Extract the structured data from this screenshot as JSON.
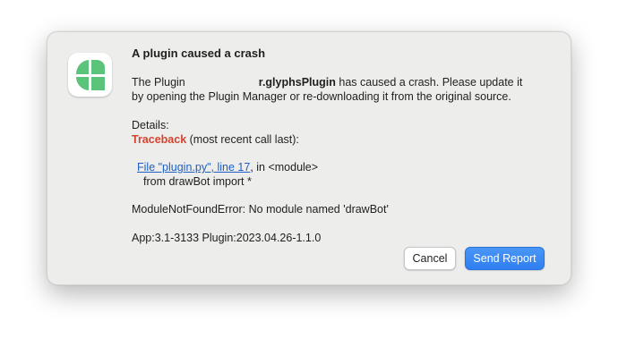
{
  "dialog": {
    "title": "A plugin caused a crash",
    "message_prefix": "The Plugin",
    "plugin_name": "r.glyphsPlugin",
    "message_line1_suffix": " has caused a crash. Please update it",
    "message_line2": "by opening the Plugin Manager or re-downloading it from the original source.",
    "details_label": "Details:",
    "traceback_word": "Traceback",
    "traceback_rest": " (most recent call last):",
    "frame_link": "File \"plugin.py\", line 17",
    "frame_link_suffix": ", in <module>",
    "frame_code": "from drawBot import *",
    "error_line": "ModuleNotFoundError: No module named 'drawBot'",
    "app_line": "App:3.1-3133 Plugin:2023.04.26-1.1.0"
  },
  "buttons": {
    "cancel_label": "Cancel",
    "send_label": "Send Report"
  },
  "icon": {
    "name": "glyphs-app-icon",
    "color": "#5cc47a"
  },
  "colors": {
    "accent": "#2f7ef0",
    "traceback": "#d5432f",
    "link": "#1f5fc4"
  }
}
